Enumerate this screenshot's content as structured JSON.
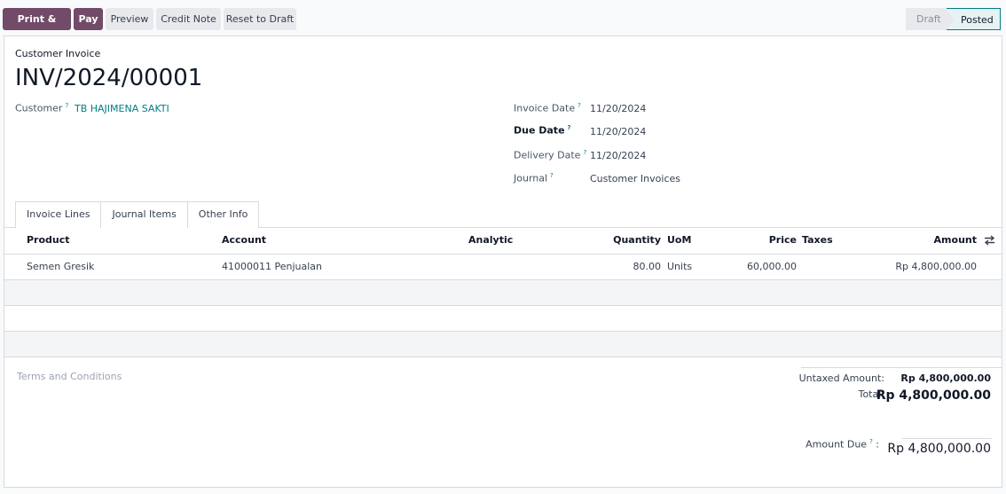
{
  "toolbar": {
    "print_send": "Print & Send",
    "pay": "Pay",
    "preview": "Preview",
    "credit_note": "Credit Note",
    "reset_draft": "Reset to Draft"
  },
  "status": {
    "draft": "Draft",
    "posted": "Posted",
    "current": "Posted"
  },
  "header": {
    "doc_type": "Customer Invoice",
    "number": "INV/2024/00001"
  },
  "fields": {
    "customer_label": "Customer",
    "customer": "TB HAJIMENA SAKTI",
    "invoice_date_label": "Invoice Date",
    "invoice_date": "11/20/2024",
    "due_date_label": "Due Date",
    "due_date": "11/20/2024",
    "delivery_date_label": "Delivery Date",
    "delivery_date": "11/20/2024",
    "journal_label": "Journal",
    "journal": "Customer Invoices",
    "help": "?"
  },
  "tabs": [
    "Invoice Lines",
    "Journal Items",
    "Other Info"
  ],
  "table": {
    "columns": {
      "product": "Product",
      "account": "Account",
      "analytic": "Analytic",
      "quantity": "Quantity",
      "uom": "UoM",
      "price": "Price",
      "taxes": "Taxes",
      "amount": "Amount"
    },
    "rows": [
      {
        "product": "Semen Gresik",
        "account": "41000011 Penjualan",
        "analytic": "",
        "quantity": "80.00",
        "uom": "Units",
        "price": "60,000.00",
        "taxes": "",
        "amount": "Rp 4,800,000.00"
      }
    ]
  },
  "footer": {
    "terms_placeholder": "Terms and Conditions",
    "untaxed_label": "Untaxed Amount:",
    "untaxed": "Rp 4,800,000.00",
    "total_label": "Total:",
    "total": "Rp 4,800,000.00",
    "amount_due_label": "Amount Due",
    "amount_due_colon": ":",
    "amount_due": "Rp 4,800,000.00"
  },
  "colors": {
    "primary": "#714b67",
    "link": "#017e84",
    "posted_bg": "#e6f2f3"
  }
}
